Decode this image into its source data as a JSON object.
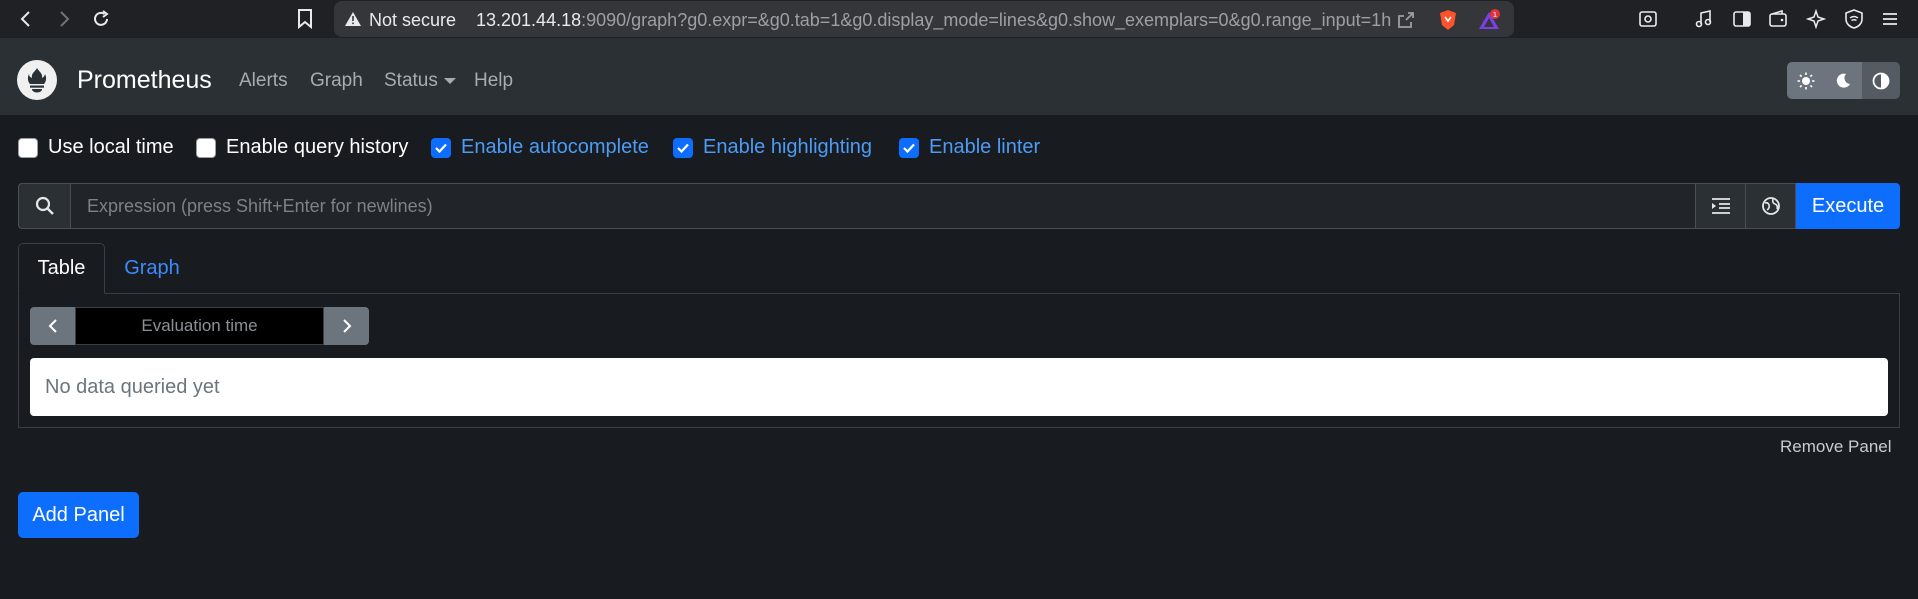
{
  "browser": {
    "not_secure_label": "Not secure",
    "url_host": "13.201.44.18",
    "url_rest": ":9090/graph?g0.expr=&g0.tab=1&g0.display_mode=lines&g0.show_exemplars=0&g0.range_input=1h",
    "notification_badge": "1"
  },
  "navbar": {
    "brand": "Prometheus",
    "links": [
      "Alerts",
      "Graph",
      "Status",
      "Help"
    ]
  },
  "options": [
    {
      "label": "Use local time",
      "checked": false
    },
    {
      "label": "Enable query history",
      "checked": false
    },
    {
      "label": "Enable autocomplete",
      "checked": true
    },
    {
      "label": "Enable highlighting",
      "checked": true
    },
    {
      "label": "Enable linter",
      "checked": true
    }
  ],
  "expression": {
    "placeholder": "Expression (press Shift+Enter for newlines)",
    "execute_label": "Execute"
  },
  "panel": {
    "tabs": [
      "Table",
      "Graph"
    ],
    "active_tab": "Table",
    "eval_placeholder": "Evaluation time",
    "no_data": "No data queried yet",
    "remove_label": "Remove Panel"
  },
  "add_panel_label": "Add Panel",
  "colors": {
    "accent": "#0d6efd",
    "link_active": "#3d8bfd",
    "navbar_bg": "#2b3035",
    "page_bg": "#181b1f"
  }
}
